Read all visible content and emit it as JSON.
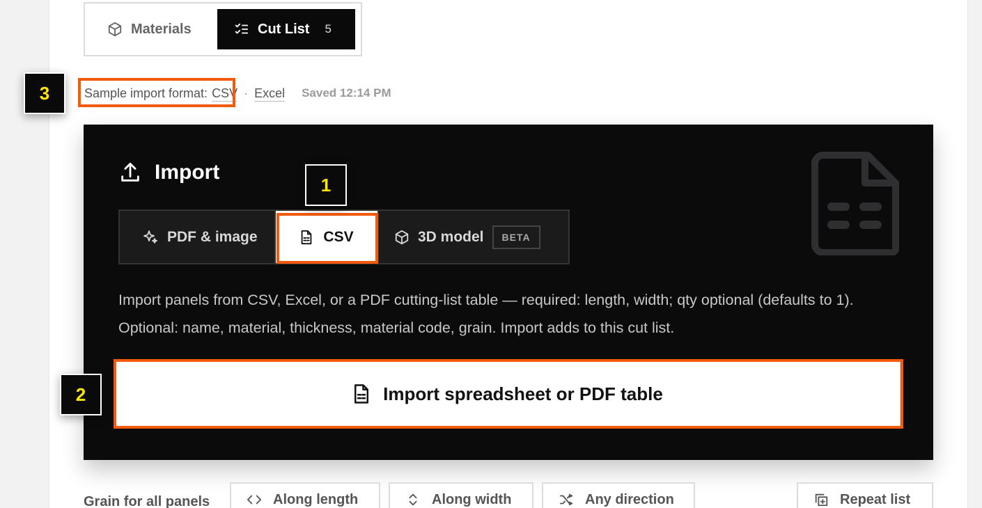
{
  "tabs": {
    "materials_label": "Materials",
    "cutlist_label": "Cut List",
    "cutlist_count": "5"
  },
  "format_line": {
    "label": "Sample import format:",
    "csv_link": "CSV",
    "separator": "·",
    "excel_link": "Excel",
    "saved": "Saved 12:14 PM"
  },
  "import_panel": {
    "title": "Import",
    "modes": {
      "pdf": "PDF & image",
      "csv": "CSV",
      "model": "3D model",
      "beta": "BETA"
    },
    "selected_mode": "CSV",
    "description": "Import panels from CSV, Excel, or a PDF cutting-list table — required: length, width; qty optional (defaults to 1). Optional: name, material, thickness, material code, grain. Import adds to this cut list.",
    "button_label": "Import spreadsheet or PDF table"
  },
  "grain": {
    "label": "Grain for all panels",
    "along_length": "Along length",
    "along_width": "Along width",
    "any_direction": "Any direction",
    "repeat_list": "Repeat list"
  },
  "annotations": {
    "one": "1",
    "two": "2",
    "three": "3"
  },
  "colors": {
    "highlight": "#f25a0c",
    "marker_text": "#ffe600",
    "panel_bg": "#0b0b0c"
  }
}
